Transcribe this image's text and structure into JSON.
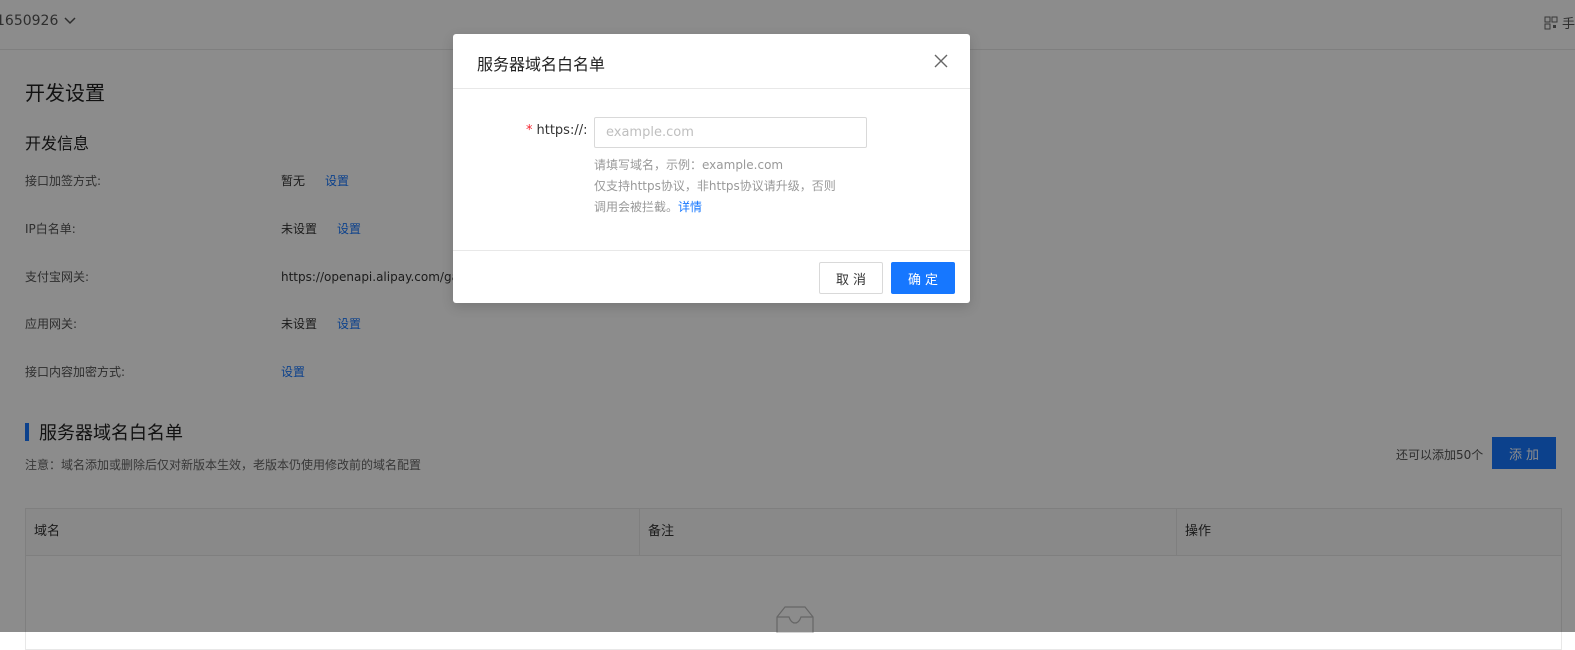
{
  "topbar": {
    "account_id": "1650926",
    "right_label": "手"
  },
  "page_title": "开发设置",
  "dev_info": {
    "title": "开发信息",
    "rows": [
      {
        "label": "接口加签方式:",
        "value": "暂无",
        "link": "设置"
      },
      {
        "label": "IP白名单:",
        "value": "未设置",
        "link": "设置"
      },
      {
        "label": "支付宝网关:",
        "value": "https://openapi.alipay.com/ga",
        "link": ""
      },
      {
        "label": "应用网关:",
        "value": "未设置",
        "link": "设置"
      },
      {
        "label": "接口内容加密方式:",
        "value": "",
        "link": "设置"
      }
    ]
  },
  "whitelist": {
    "title": "服务器域名白名单",
    "note": "注意：域名添加或删除后仅对新版本生效，老版本仍使用修改前的域名配置",
    "quota": "还可以添加50个",
    "add_label": "添加",
    "columns": [
      "域名",
      "备注",
      "操作"
    ]
  },
  "modal": {
    "title": "服务器域名白名单",
    "field_label": "https://:",
    "field_value": "",
    "field_placeholder": "example.com",
    "help_line1": "请填写域名，示例：example.com",
    "help_line2": "仅支持https协议，非https协议请升级，否则",
    "help_line3": "调用会被拦截。",
    "help_link": "详情",
    "cancel_label": "取消",
    "ok_label": "确定"
  },
  "colors": {
    "primary": "#1677ff",
    "required": "#f5222d",
    "mask": "rgba(0,0,0,0.45)"
  }
}
